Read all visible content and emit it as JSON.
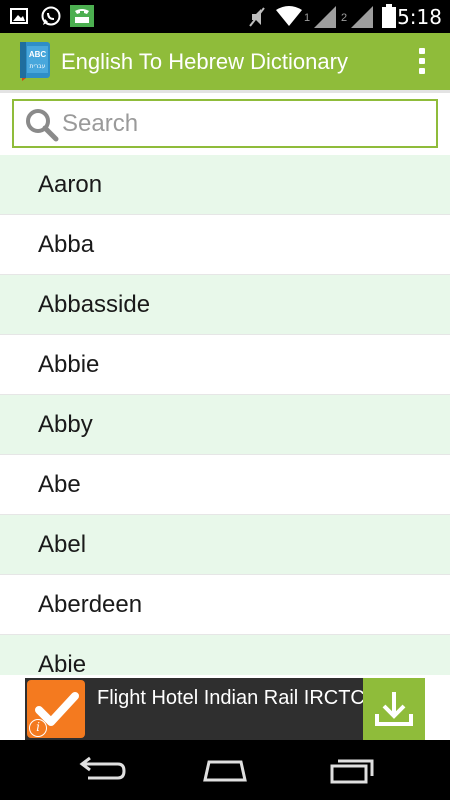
{
  "status_bar": {
    "time": "5:18",
    "sim1_label": "1",
    "sim2_label": "2",
    "icons": [
      "gallery-icon",
      "whatsapp-icon",
      "call-icon",
      "mute-icon",
      "wifi-icon",
      "signal-icon",
      "battery-icon"
    ]
  },
  "app_bar": {
    "title": "English To Hebrew Dictionary",
    "icon_text_top": "ABC",
    "icon_text_bottom": "עברית",
    "accent_color": "#8fbc3a"
  },
  "search": {
    "placeholder": "Search",
    "value": ""
  },
  "word_list": {
    "items": [
      "Aaron",
      "Abba",
      "Abbasside",
      "Abbie",
      "Abby",
      "Abe",
      "Abel",
      "Aberdeen",
      "Abie"
    ],
    "alt_row_color": "#e8f8ea"
  },
  "ad": {
    "text": "Flight Hotel Indian Rail IRCTC",
    "info_label": "i",
    "logo_color": "#f47a1f"
  },
  "nav_bar": {
    "buttons": [
      "back-icon",
      "home-icon",
      "recent-apps-icon"
    ]
  }
}
